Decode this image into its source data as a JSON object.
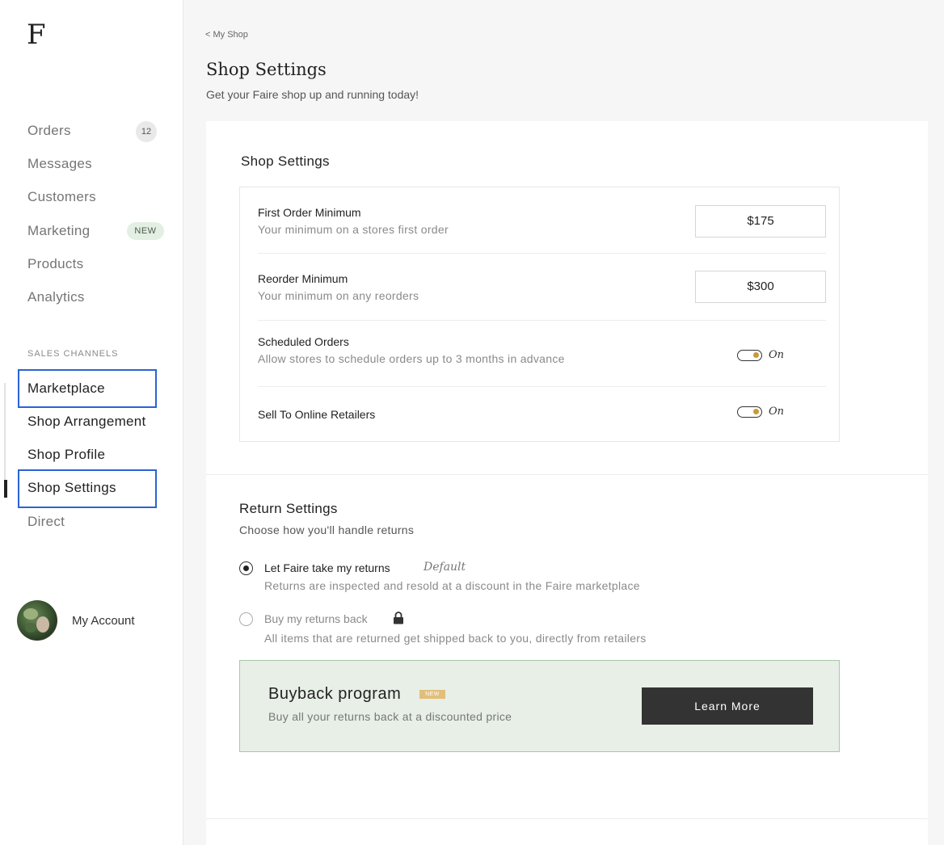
{
  "brand": {
    "logo": "F"
  },
  "sidebar": {
    "items": [
      {
        "label": "Orders",
        "badge": "12"
      },
      {
        "label": "Messages"
      },
      {
        "label": "Customers"
      },
      {
        "label": "Marketing",
        "badge": "NEW"
      },
      {
        "label": "Products"
      },
      {
        "label": "Analytics"
      }
    ],
    "sales_channels_label": "SALES CHANNELS",
    "channels": [
      {
        "label": "Marketplace"
      },
      {
        "label": "Shop Arrangement"
      },
      {
        "label": "Shop Profile"
      },
      {
        "label": "Shop Settings",
        "active": true
      },
      {
        "label": "Direct"
      }
    ],
    "account_label": "My Account"
  },
  "header": {
    "breadcrumb": "< My Shop",
    "title": "Shop Settings",
    "subtitle": "Get your Faire shop up and running today!"
  },
  "shop_settings": {
    "title": "Shop Settings",
    "rows": [
      {
        "title": "First Order Minimum",
        "desc": "Your minimum on a stores first order",
        "value": "$175"
      },
      {
        "title": "Reorder Minimum",
        "desc": "Your minimum on any reorders",
        "value": "$300"
      },
      {
        "title": "Scheduled Orders",
        "desc": "Allow stores to schedule orders up to 3 months in advance",
        "toggle": "On"
      },
      {
        "title": "Sell To Online Retailers",
        "toggle": "On"
      }
    ]
  },
  "return_settings": {
    "title": "Return Settings",
    "subtitle": "Choose how you'll handle returns",
    "options": [
      {
        "title": "Let Faire take my returns",
        "tag": "Default",
        "desc": "Returns are inspected and resold at a discount in the Faire marketplace",
        "selected": true
      },
      {
        "title": "Buy my returns back",
        "desc": "All items that are returned get shipped back to you, directly from retailers",
        "selected": false,
        "icon": "lock-icon"
      }
    ]
  },
  "buyback": {
    "title": "Buyback program",
    "badge": "NEW",
    "desc": "Buy all your returns back at a discounted price",
    "button": "Learn More"
  },
  "colors": {
    "accent_highlight": "#2a63d6",
    "toggle_knob": "#c99a3a",
    "buyback_bg": "#e7efe7",
    "button_bg": "#333333"
  }
}
